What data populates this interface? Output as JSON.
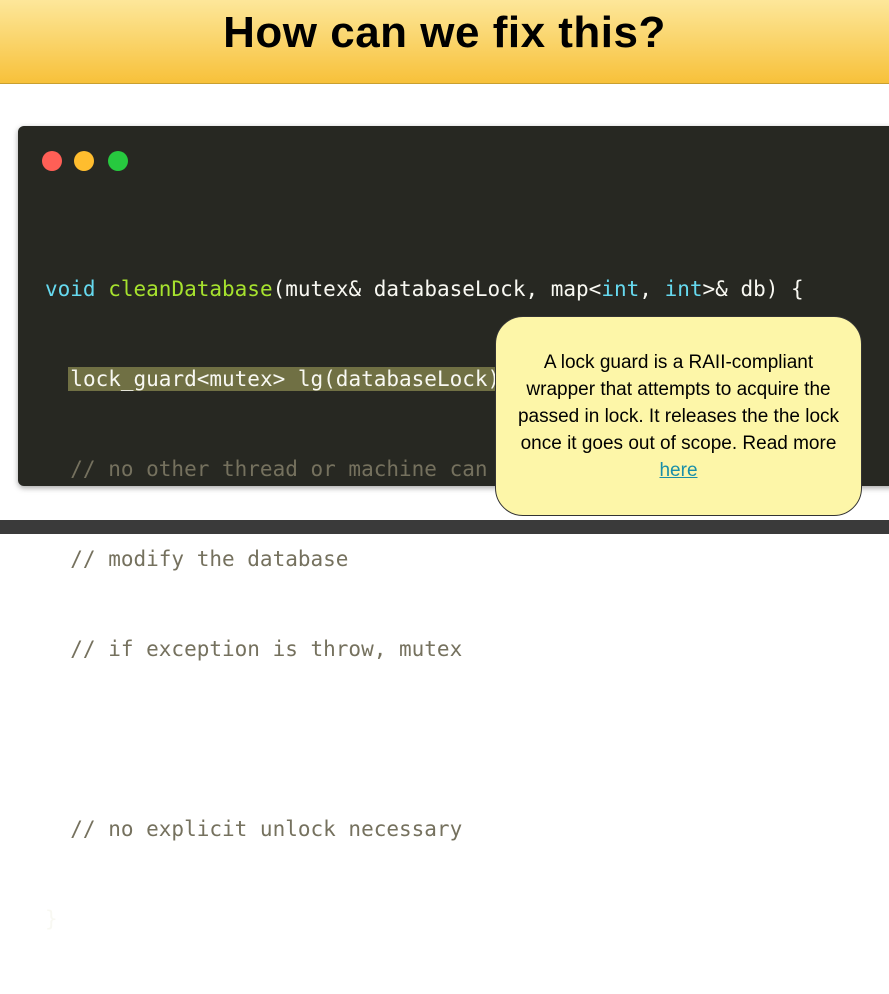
{
  "slide": {
    "title": "How can we fix this?"
  },
  "code": {
    "l1_void": "void",
    "l1_fn": "cleanDatabase",
    "l1_a": "(mutex& databaseLock, map<",
    "l1_int1": "int",
    "l1_b": ", ",
    "l1_int2": "int",
    "l1_c": ">& db) {",
    "l2_indent": "  ",
    "l2_highlight": "lock_guard<mutex> lg(databaseLock);",
    "l3": "  // no other thread or machine can change database",
    "l4": "  // modify the database",
    "l5": "  // if exception is throw, mutex",
    "l6": "",
    "l7": "  // no explicit unlock necessary",
    "l8": "}"
  },
  "tooltip": {
    "text": "A lock guard is a RAII-compliant wrapper that attempts to acquire the passed in lock. It releases the the lock once it goes out of scope. Read more ",
    "link": "here"
  },
  "colors": {
    "header_top": "#fde79a",
    "header_bottom": "#f7c13a",
    "editor_bg": "#272822",
    "tooltip_bg": "#fdf6a8"
  }
}
